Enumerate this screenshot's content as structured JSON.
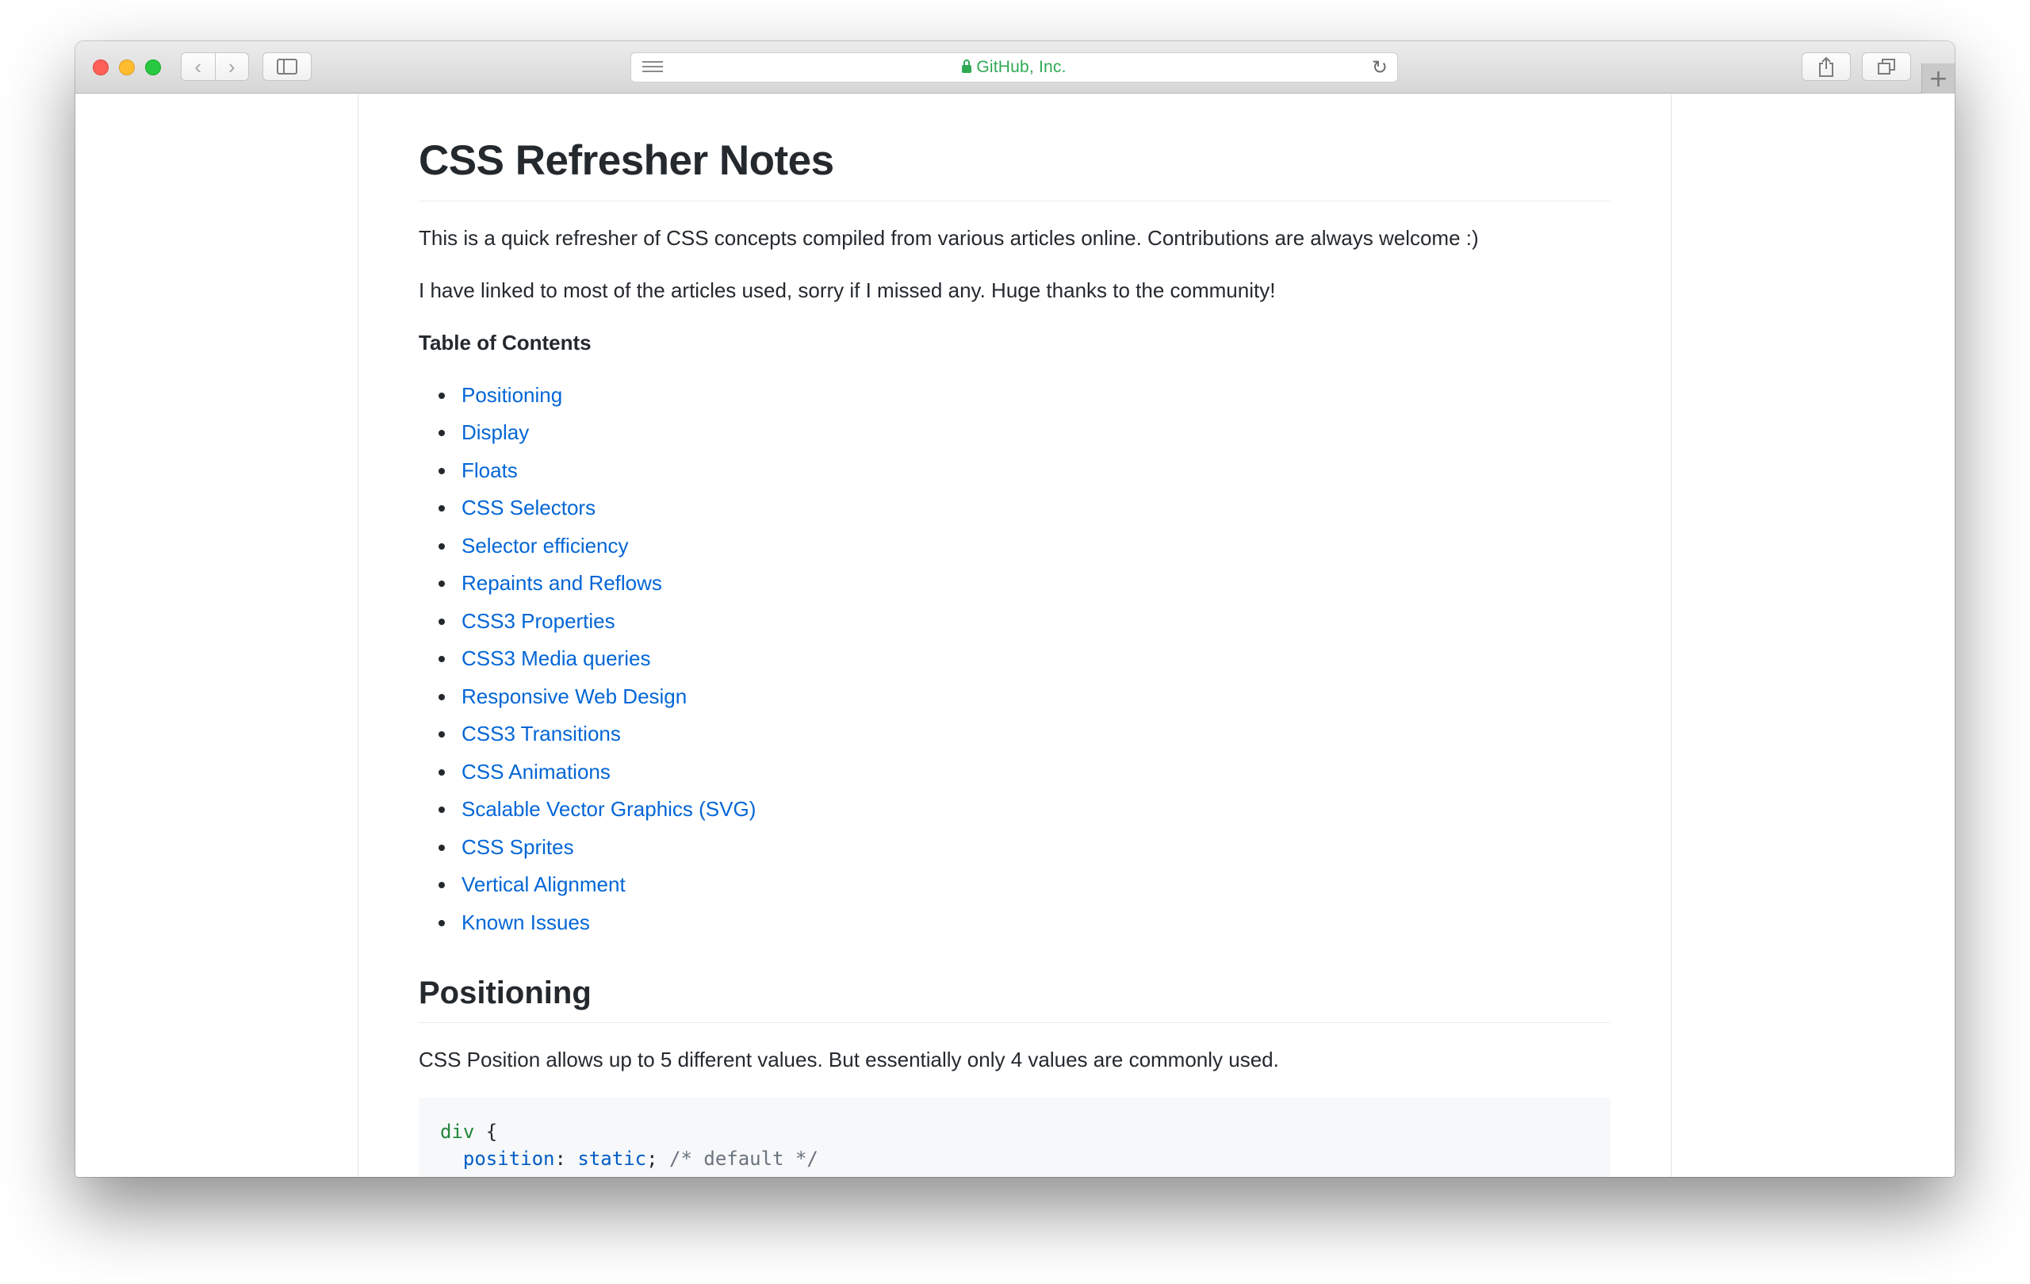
{
  "browser": {
    "url_display": "GitHub, Inc.",
    "url_color": "#2eaa55",
    "icons": [
      "close-icon",
      "minimize-icon",
      "maximize-icon",
      "back-icon",
      "forward-icon",
      "sidebar-icon",
      "reader-icon",
      "lock-icon",
      "reload-icon",
      "share-icon",
      "tabs-icon",
      "new-tab-icon"
    ]
  },
  "article": {
    "title": "CSS Refresher Notes",
    "intro_1": "This is a quick refresher of CSS concepts compiled from various articles online. Contributions are always welcome :)",
    "intro_2": "I have linked to most of the articles used, sorry if I missed any. Huge thanks to the community!",
    "toc_title": "Table of Contents",
    "toc": [
      "Positioning",
      "Display",
      "Floats",
      "CSS Selectors",
      "Selector efficiency",
      "Repaints and Reflows",
      "CSS3 Properties",
      "CSS3 Media queries",
      "Responsive Web Design",
      "CSS3 Transitions",
      "CSS Animations",
      "Scalable Vector Graphics (SVG)",
      "CSS Sprites",
      "Vertical Alignment",
      "Known Issues"
    ],
    "section_heading": "Positioning",
    "section_text": "CSS Position allows up to 5 different values. But essentially only 4 values are commonly used.",
    "code": {
      "line1_selector": "div",
      "line1_brace": " {",
      "line2_prop": "position",
      "line2_colon": ": ",
      "line2_value": "static",
      "line2_semi": "; ",
      "line2_comment": "/* default */"
    },
    "link_color": "#0366d6"
  }
}
